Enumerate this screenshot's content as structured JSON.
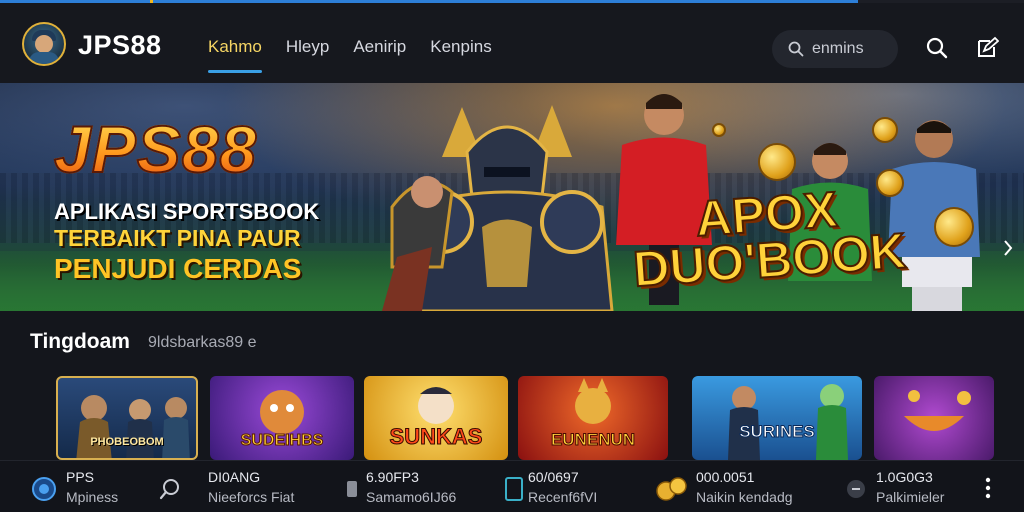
{
  "header": {
    "brand": "JPS88",
    "nav": [
      {
        "label": "Kahmo",
        "active": true
      },
      {
        "label": "Hleyp",
        "active": false
      },
      {
        "label": "Aenirip",
        "active": false
      },
      {
        "label": "Kenpins",
        "active": false
      }
    ],
    "search_placeholder": "enmins",
    "icons": [
      "search-icon",
      "edit-icon"
    ]
  },
  "banner": {
    "title": "JPS88",
    "line1": "APLIKASI SPORTSBOOK",
    "line2": "TERBAIKT PINA PAUR",
    "line3": "PENJUDI CERDAS",
    "promo": "APOX DUO'BOOK",
    "next_icon": "chevron-right-icon"
  },
  "section": {
    "title": "Tingdoam",
    "subtitle": "9ldsbarkas89 e"
  },
  "games": [
    {
      "label": "PHOBEOBOM",
      "bg": "#1c3a66"
    },
    {
      "label": "SUDEIHBS",
      "bg": "#5a2aa8"
    },
    {
      "label": "SUNKAS",
      "bg": "#e6b020"
    },
    {
      "label": "EUNENUN",
      "bg": "#b8321a"
    },
    {
      "label": "SURINES",
      "bg": "#2a7ab8"
    },
    {
      "label": "",
      "bg": "#7a2a9a"
    }
  ],
  "bottom_bar": [
    {
      "value": "PPS",
      "caption": "Mpiness",
      "icon": "globe-icon"
    },
    {
      "value": "",
      "caption": "",
      "icon": "search-icon"
    },
    {
      "value": "DI0ANG",
      "caption": "Nieeforcs Fiat",
      "icon": ""
    },
    {
      "value": "6.90FP3",
      "caption": "Samamo6IJ66",
      "icon": "phone-icon"
    },
    {
      "value": "60/0697",
      "caption": "Recenf6fVI",
      "icon": "tablet-icon"
    },
    {
      "value": "000.0051",
      "caption": "Naikin kendadg",
      "icon": "coins-icon"
    },
    {
      "value": "1.0G0G3",
      "caption": "Palkimieler",
      "icon": "chat-icon"
    }
  ],
  "colors": {
    "accent": "#f5d564",
    "underline": "#3aa0e6",
    "background": "#14161c"
  }
}
